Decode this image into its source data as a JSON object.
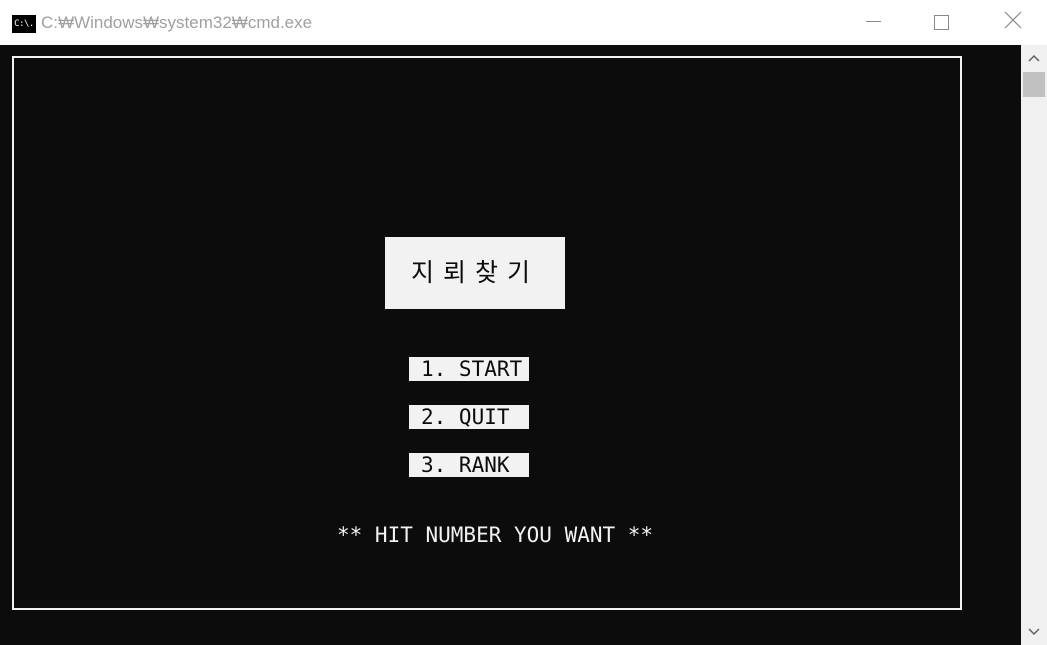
{
  "window": {
    "title": "C:₩Windows₩system32₩cmd.exe",
    "icon": "cmd-icon",
    "icon_text": "C:\\."
  },
  "controls": {
    "minimize_icon": "minimize-icon",
    "maximize_icon": "maximize-icon",
    "close_icon": "close-icon"
  },
  "game": {
    "title": "지뢰찾기",
    "menu": [
      {
        "label": "1. START"
      },
      {
        "label": "2. QUIT"
      },
      {
        "label": "3. RANK"
      }
    ],
    "prompt": "** HIT NUMBER YOU WANT **"
  },
  "colors": {
    "console_bg": "#0c0c0c",
    "console_fg": "#f2f2f2",
    "titlebar_bg": "#ffffff",
    "scrollbar_bg": "#f0f0f0",
    "scrollbar_thumb": "#c1c1c1"
  },
  "scrollbar": {
    "up_icon": "scroll-up-arrow-icon",
    "down_icon": "scroll-down-arrow-icon"
  }
}
